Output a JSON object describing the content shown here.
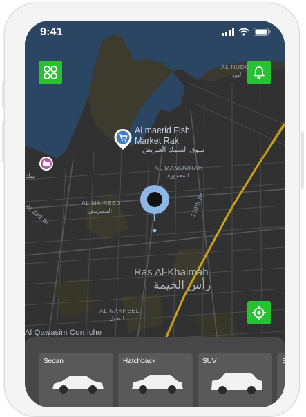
{
  "status_bar": {
    "time": "9:41"
  },
  "map": {
    "poi": {
      "name_line1": "Al maerid Fish",
      "name_line2": "Market Rak",
      "name_ar": "سوق السمك العيريض"
    },
    "labels": {
      "al_nudood": "AL NUDO",
      "al_nudood_ar": "النود",
      "al_mamourah": "AL MAMOURAH",
      "al_mamourah_ar": "المعمورة",
      "al_mairid": "AL MAIREED",
      "al_mairid_ar": "المعيريض",
      "al_zad_st": "Al Zad St",
      "st_120th": "120th St",
      "al_nakheel": "AL NAKHEEL",
      "al_nakheel_ar": "النخيل",
      "corniche": "Al Qawasim Corniche",
      "city_en": "Ras Al-Khaimah",
      "city_ar": "رأس الخيمة",
      "left_edge_ar": "بيك"
    }
  },
  "vehicles": [
    {
      "label": "Sedan"
    },
    {
      "label": "Hatchback"
    },
    {
      "label": "SUV"
    },
    {
      "label": "Se"
    }
  ],
  "colors": {
    "accent": "#26c230",
    "map_bg": "#313131",
    "water": "#2b4663",
    "road_major": "#c9a21a",
    "pin": "#8cb6e4"
  }
}
